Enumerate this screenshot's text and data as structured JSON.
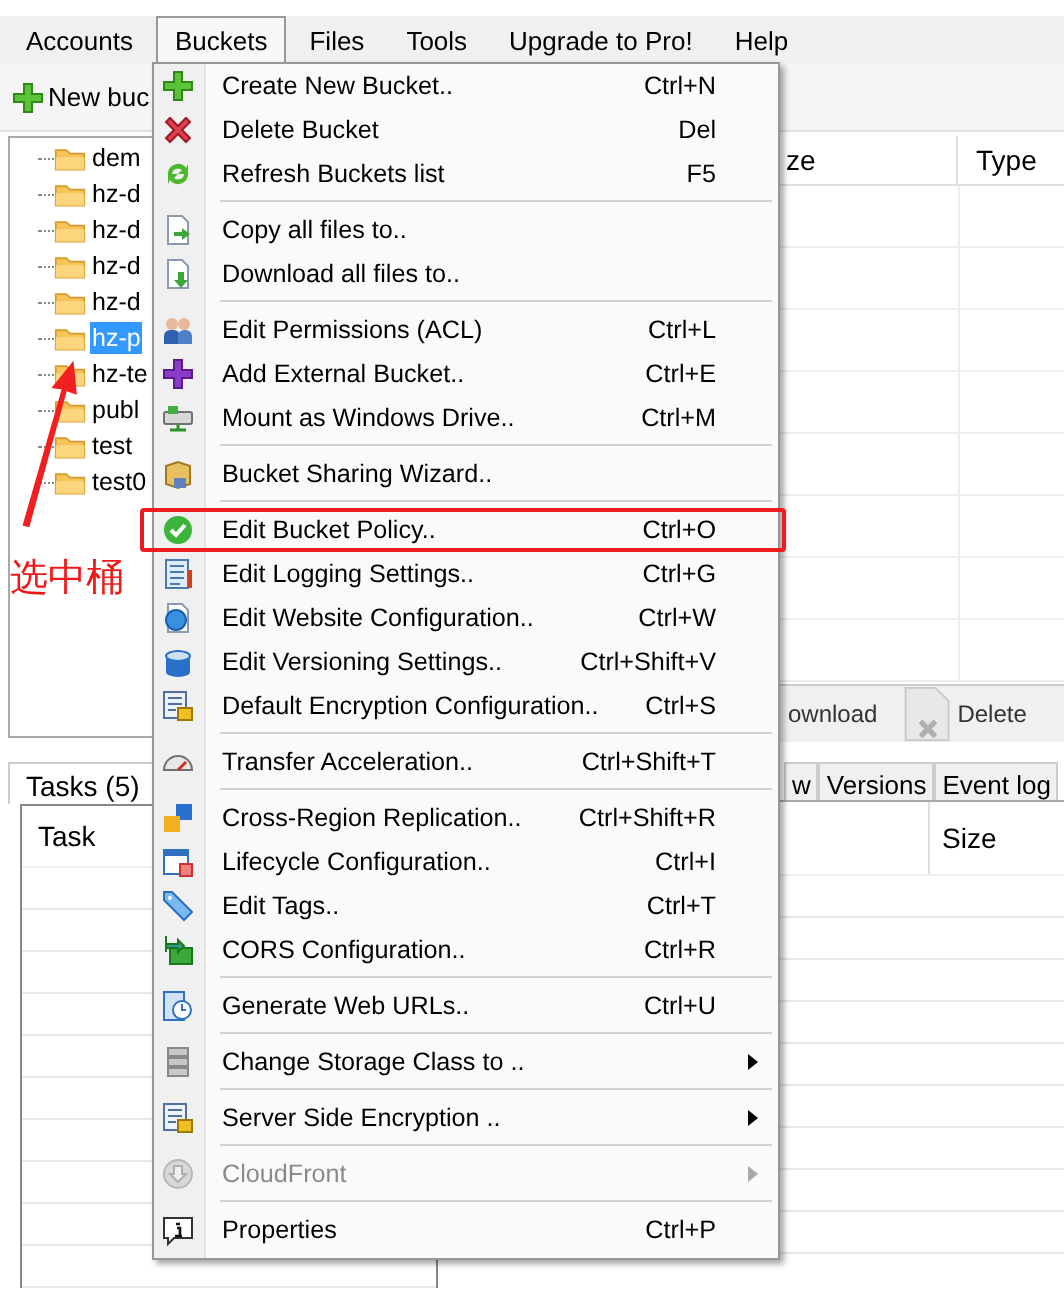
{
  "menubar": [
    {
      "label": "Accounts",
      "selected": false
    },
    {
      "label": "Buckets",
      "selected": true
    },
    {
      "label": "Files",
      "selected": false
    },
    {
      "label": "Tools",
      "selected": false
    },
    {
      "label": "Upgrade to Pro!",
      "selected": false
    },
    {
      "label": "Help",
      "selected": false
    }
  ],
  "toolbar": {
    "new_button": "New buc"
  },
  "bucket_tree": [
    {
      "label": "dem",
      "selected": false
    },
    {
      "label": "hz-d",
      "selected": false
    },
    {
      "label": "hz-d",
      "selected": false
    },
    {
      "label": "hz-d",
      "selected": false
    },
    {
      "label": "hz-d",
      "selected": false
    },
    {
      "label": "hz-p",
      "selected": true
    },
    {
      "label": "hz-te",
      "selected": false
    },
    {
      "label": "publ",
      "selected": false
    },
    {
      "label": "test",
      "selected": false
    },
    {
      "label": "test0",
      "selected": false
    }
  ],
  "file_list": {
    "columns": [
      "ze",
      "Type"
    ]
  },
  "file_toolbar": {
    "download": "ownload",
    "delete": "Delete"
  },
  "tasks": {
    "tab": "Tasks (5)",
    "columns": [
      "Task"
    ]
  },
  "detail_tabs": [
    {
      "label": "w",
      "selected": false
    },
    {
      "label": "Versions",
      "selected": false
    },
    {
      "label": "Event log",
      "selected": false
    }
  ],
  "detail_table": {
    "columns": [
      "Size"
    ]
  },
  "buckets_menu": [
    {
      "kind": "item",
      "label": "Create New Bucket..",
      "shortcut": "Ctrl+N",
      "submenu": false,
      "disabled": false,
      "boxed": false
    },
    {
      "kind": "item",
      "label": "Delete Bucket",
      "shortcut": "Del",
      "submenu": false,
      "disabled": false,
      "boxed": false
    },
    {
      "kind": "item",
      "label": "Refresh Buckets list",
      "shortcut": "F5",
      "submenu": false,
      "disabled": false,
      "boxed": false
    },
    {
      "kind": "separator"
    },
    {
      "kind": "item",
      "label": "Copy all files to..",
      "submenu": false,
      "disabled": false,
      "boxed": false
    },
    {
      "kind": "item",
      "label": "Download all files to..",
      "submenu": false,
      "disabled": false,
      "boxed": false
    },
    {
      "kind": "separator"
    },
    {
      "kind": "item",
      "label": "Edit Permissions (ACL)",
      "shortcut": "Ctrl+L",
      "submenu": false,
      "disabled": false,
      "boxed": false
    },
    {
      "kind": "item",
      "label": "Add External Bucket..",
      "shortcut": "Ctrl+E",
      "submenu": false,
      "disabled": false,
      "boxed": false
    },
    {
      "kind": "item",
      "label": "Mount as Windows Drive..",
      "shortcut": "Ctrl+M",
      "submenu": false,
      "disabled": false,
      "boxed": false
    },
    {
      "kind": "separator"
    },
    {
      "kind": "item",
      "label": "Bucket Sharing Wizard..",
      "submenu": false,
      "disabled": false,
      "boxed": false
    },
    {
      "kind": "separator"
    },
    {
      "kind": "item",
      "label": "Edit Bucket Policy..",
      "shortcut": "Ctrl+O",
      "submenu": false,
      "disabled": false,
      "boxed": true
    },
    {
      "kind": "item",
      "label": "Edit Logging Settings..",
      "shortcut": "Ctrl+G",
      "submenu": false,
      "disabled": false,
      "boxed": false
    },
    {
      "kind": "item",
      "label": "Edit Website Configuration..",
      "shortcut": "Ctrl+W",
      "submenu": false,
      "disabled": false,
      "boxed": false
    },
    {
      "kind": "item",
      "label": "Edit Versioning Settings..",
      "shortcut": "Ctrl+Shift+V",
      "submenu": false,
      "disabled": false,
      "boxed": false
    },
    {
      "kind": "item",
      "label": "Default Encryption Configuration..",
      "shortcut": "Ctrl+S",
      "submenu": false,
      "disabled": false,
      "boxed": false
    },
    {
      "kind": "separator"
    },
    {
      "kind": "item",
      "label": "Transfer Acceleration..",
      "shortcut": "Ctrl+Shift+T",
      "submenu": false,
      "disabled": false,
      "boxed": false
    },
    {
      "kind": "separator"
    },
    {
      "kind": "item",
      "label": "Cross-Region Replication..",
      "shortcut": "Ctrl+Shift+R",
      "submenu": false,
      "disabled": false,
      "boxed": false
    },
    {
      "kind": "item",
      "label": "Lifecycle Configuration..",
      "shortcut": "Ctrl+I",
      "submenu": false,
      "disabled": false,
      "boxed": false
    },
    {
      "kind": "item",
      "label": "Edit Tags..",
      "shortcut": "Ctrl+T",
      "submenu": false,
      "disabled": false,
      "boxed": false
    },
    {
      "kind": "item",
      "label": "CORS Configuration..",
      "shortcut": "Ctrl+R",
      "submenu": false,
      "disabled": false,
      "boxed": false
    },
    {
      "kind": "separator"
    },
    {
      "kind": "item",
      "label": "Generate Web URLs..",
      "shortcut": "Ctrl+U",
      "submenu": false,
      "disabled": false,
      "boxed": false
    },
    {
      "kind": "separator"
    },
    {
      "kind": "item",
      "label": "Change Storage Class to ..",
      "submenu": true,
      "disabled": false,
      "boxed": false
    },
    {
      "kind": "separator"
    },
    {
      "kind": "item",
      "label": "Server Side Encryption ..",
      "submenu": true,
      "disabled": false,
      "boxed": false
    },
    {
      "kind": "separator"
    },
    {
      "kind": "item",
      "label": "CloudFront",
      "submenu": true,
      "disabled": true,
      "boxed": false
    },
    {
      "kind": "separator"
    },
    {
      "kind": "item",
      "label": "Properties",
      "shortcut": "Ctrl+P",
      "submenu": false,
      "disabled": false,
      "boxed": false
    }
  ],
  "annotation": {
    "label": "选中桶"
  }
}
